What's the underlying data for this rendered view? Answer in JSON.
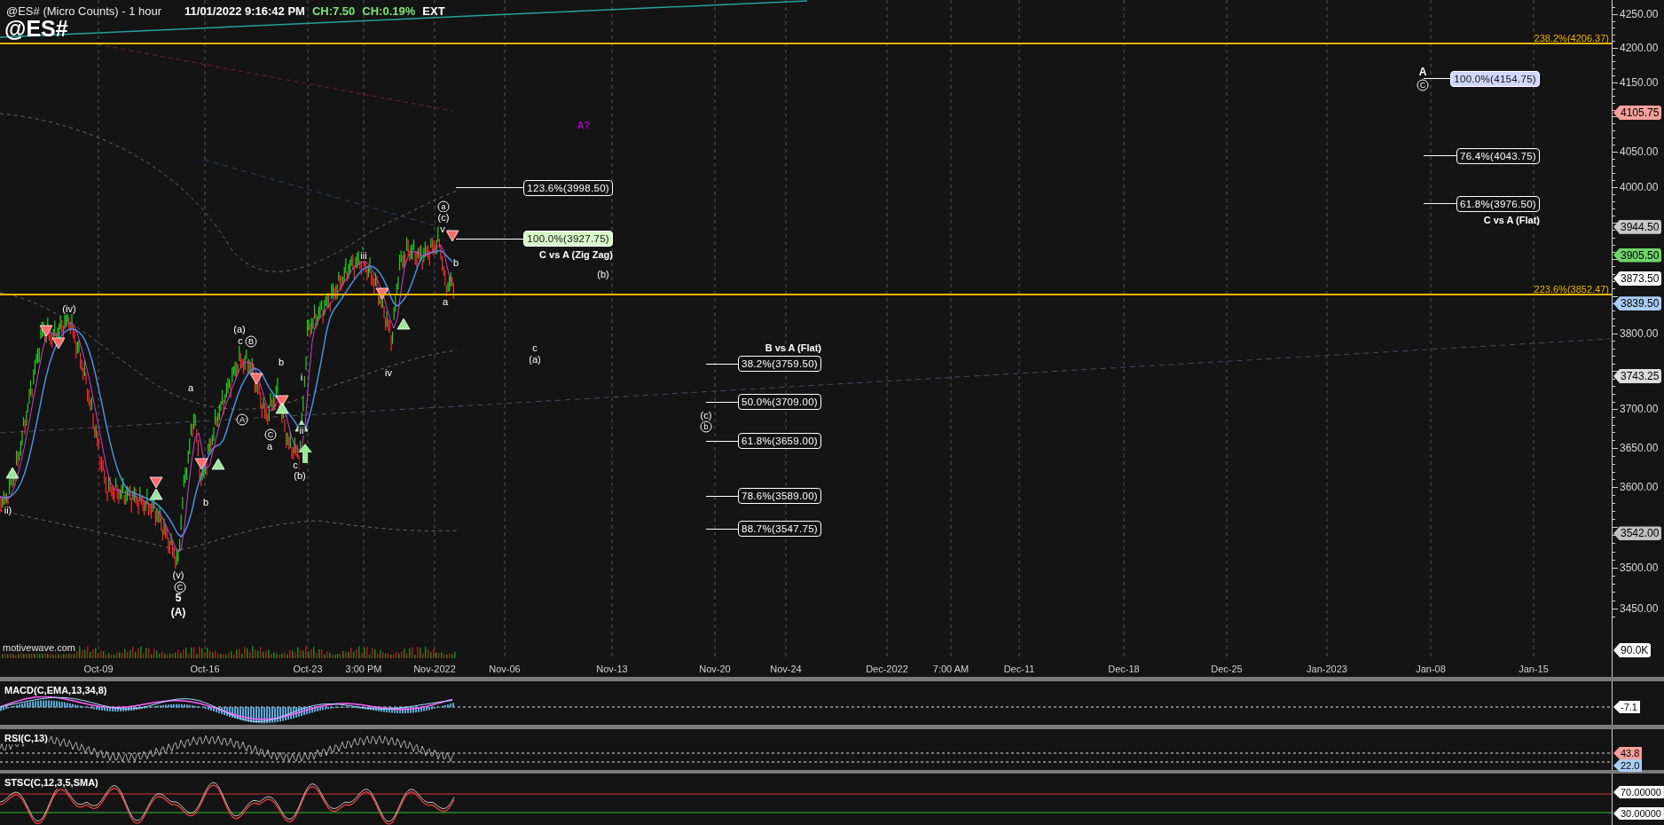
{
  "header": {
    "title": "@ES# (Micro Counts) - 1 hour",
    "datetime": "11/01/2022 9:16:42 PM",
    "change": "CH:7.50",
    "change_percent": "CH:0.19%",
    "session": "EXT"
  },
  "symbol": "@ES#",
  "price_axis": {
    "labels": [
      "4250.00",
      "4200.00",
      "4150.00",
      "4050.00",
      "4000.00",
      "3800.00",
      "3700.00",
      "3650.00",
      "3600.00",
      "3500.00",
      "3450.00"
    ],
    "tags": [
      {
        "text": "4105.75",
        "kind": "price",
        "color": "#f4a09a"
      },
      {
        "text": "3944.50",
        "kind": "price",
        "color": "#c8c8c8"
      },
      {
        "text": "3905.50",
        "kind": "price",
        "color": "#6fd46a"
      },
      {
        "text": "3873.50",
        "kind": "price",
        "color": "#ffffff"
      },
      {
        "text": "3839.50",
        "kind": "price",
        "color": "#a9cdf5"
      },
      {
        "text": "3743.25",
        "kind": "price",
        "color": "#dcdcdc"
      },
      {
        "text": "3542.00",
        "kind": "price",
        "color": "#c0c0c0"
      },
      {
        "text": "90.0K",
        "kind": "volume",
        "color": "#ffffff"
      }
    ]
  },
  "fib_lines": [
    {
      "label": "238.2%(4206.37)"
    },
    {
      "label": "223.6%(3852.47)"
    }
  ],
  "fib_groups": [
    {
      "title": "C vs A (Zig Zag)",
      "levels": [
        {
          "label": "123.6%(3998.50)"
        },
        {
          "label": "100.0%(3927.75)",
          "color": "#d9f7c9"
        }
      ]
    },
    {
      "title": "B vs A (Flat)",
      "levels": [
        {
          "label": "38.2%(3759.50)"
        },
        {
          "label": "50.0%(3709.00)"
        },
        {
          "label": "61.8%(3659.00)"
        },
        {
          "label": "78.6%(3589.00)"
        },
        {
          "label": "88.7%(3547.75)"
        }
      ]
    },
    {
      "title": "C vs A (Flat)",
      "levels": [
        {
          "label": "100.0%(4154.75)",
          "color": "#d0d8ff"
        },
        {
          "label": "76.4%(4043.75)"
        },
        {
          "label": "61.8%(3976.50)"
        }
      ]
    }
  ],
  "wave_labels": [
    {
      "text": "A?",
      "kind": "accent"
    },
    {
      "text": "A",
      "kind": "bold"
    },
    {
      "text": "C",
      "kind": "circled"
    },
    {
      "text": "a",
      "kind": "circled"
    },
    {
      "text": "(c)",
      "kind": "plain"
    },
    {
      "text": "v",
      "kind": "plain"
    },
    {
      "text": "b",
      "kind": "plain"
    },
    {
      "text": "(b)",
      "kind": "plain"
    },
    {
      "text": "iii",
      "kind": "plain"
    },
    {
      "text": "(iv)",
      "kind": "plain"
    },
    {
      "text": "a",
      "kind": "plain"
    },
    {
      "text": "(a)",
      "kind": "plain"
    },
    {
      "text": "c",
      "kind": "plain"
    },
    {
      "text": "B",
      "kind": "circled"
    },
    {
      "text": "c",
      "kind": "plain"
    },
    {
      "text": "(a)",
      "kind": "plain"
    },
    {
      "text": "b",
      "kind": "plain"
    },
    {
      "text": "iv",
      "kind": "plain"
    },
    {
      "text": "i",
      "kind": "plain"
    },
    {
      "text": "a",
      "kind": "plain"
    },
    {
      "text": "(c)",
      "kind": "plain"
    },
    {
      "text": "A",
      "kind": "circled"
    },
    {
      "text": "b",
      "kind": "circled"
    },
    {
      "text": "ii",
      "kind": "plain"
    },
    {
      "text": "C",
      "kind": "circled"
    },
    {
      "text": "a",
      "kind": "plain"
    },
    {
      "text": "c",
      "kind": "plain"
    },
    {
      "text": "(b)",
      "kind": "plain"
    },
    {
      "text": "b",
      "kind": "plain"
    },
    {
      "text": "ii)",
      "kind": "plain"
    },
    {
      "text": "(v)",
      "kind": "plain"
    },
    {
      "text": "C",
      "kind": "circled"
    },
    {
      "text": "5",
      "kind": "bold"
    },
    {
      "text": "(A)",
      "kind": "bold"
    }
  ],
  "source": "motivewave.com",
  "time_axis": [
    "Oct-09",
    "Oct-16",
    "Oct-23",
    "3:00 PM",
    "Nov-2022",
    "Nov-06",
    "Nov-13",
    "Nov-20",
    "Nov-24",
    "Dec-2022",
    "7:00 AM",
    "Dec-11",
    "Dec-18",
    "Dec-25",
    "Jan-2023",
    "Jan-08",
    "Jan-15"
  ],
  "indicators": [
    {
      "kind": "macd",
      "title": "MACD(C,EMA,13,34,8)",
      "tags": [
        {
          "text": "-7.1",
          "color": "#ffffff"
        }
      ]
    },
    {
      "kind": "rsi",
      "title": "RSI(C,13)",
      "tags": [
        {
          "text": "43.8",
          "color": "#f4a09a"
        },
        {
          "text": "22.0",
          "color": "#a9cdf5"
        }
      ]
    },
    {
      "kind": "stochastic",
      "title": "STSC(C,12,3,5,SMA)",
      "tags": [
        {
          "text": "70.00000",
          "color": "#ffffff"
        },
        {
          "text": "30.00000",
          "color": "#ffffff"
        }
      ]
    }
  ]
}
